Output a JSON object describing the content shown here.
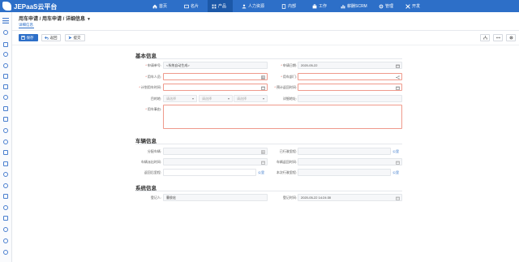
{
  "app": {
    "title": "JEPaaS云平台"
  },
  "nav": [
    {
      "label": "首页",
      "icon": "home-icon"
    },
    {
      "label": "名片",
      "icon": "card-icon"
    },
    {
      "label": "产品",
      "icon": "grid-icon",
      "active": true
    },
    {
      "label": "人力资源",
      "icon": "people-icon"
    },
    {
      "label": "内部",
      "icon": "building-icon"
    },
    {
      "label": "工作",
      "icon": "briefcase-icon"
    },
    {
      "label": "薪酬SCRM",
      "icon": "chart-icon"
    },
    {
      "label": "管理",
      "icon": "gear-icon"
    },
    {
      "label": "开发",
      "icon": "tools-icon"
    }
  ],
  "header": {
    "breadcrumb": "用车申请 / 用车申请 / 详细信息",
    "subtab": "详细信息"
  },
  "toolbar": {
    "save_label": "保存",
    "back_label": "返回",
    "submit_label": "提交"
  },
  "sections": {
    "basic": "基本信息",
    "vehicle": "车辆信息",
    "system": "系统信息"
  },
  "basic": {
    "apply_no_label": "申请单号:",
    "apply_no_value": "<系统自动生成>",
    "apply_date_label": "申请日期:",
    "apply_date_value": "2020-05-22",
    "user_label": "用车人员:",
    "dept_label": "用车部门:",
    "plan_time_label": "计划用车时间:",
    "return_time_label": "预计返回时间:",
    "destination_label": "目的地:",
    "province_placeholder": "请选择",
    "city_placeholder": "请选择",
    "district_placeholder": "请选择",
    "address_label": "详细地址:",
    "reason_label": "用车事由:"
  },
  "vehicle": {
    "assign_label": "分配车辆:",
    "start_mileage_label": "已行驶里程:",
    "out_time_label": "车辆派出时间:",
    "back_time_label": "车辆返回时间:",
    "return_mileage_label": "返回后里程:",
    "trip_mileage_label": "本次行驶里程:",
    "unit": "公里"
  },
  "system": {
    "register_label": "登记人:",
    "register_value": "曹俊宏",
    "register_time_label": "登记时间:",
    "register_time_value": "2020-05-22 14:24:30"
  }
}
